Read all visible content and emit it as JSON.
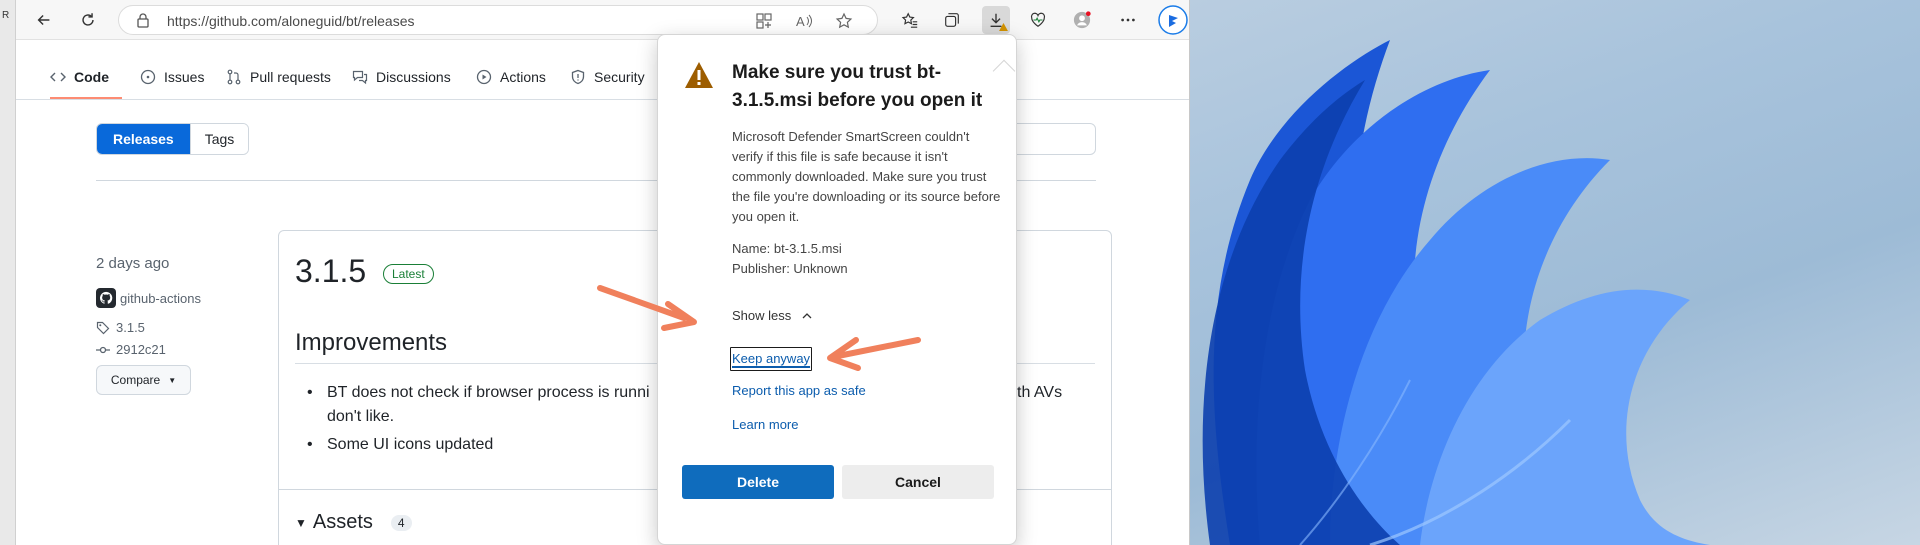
{
  "window": {
    "left_edge_label": "R"
  },
  "browser": {
    "url": "https://github.com/aloneguid/bt/releases"
  },
  "repo_nav": {
    "tabs": [
      "Code",
      "Issues",
      "Pull requests",
      "Discussions",
      "Actions",
      "Security"
    ]
  },
  "releases_page": {
    "segment_releases": "Releases",
    "segment_tags": "Tags",
    "search_placeholder_fragment": "e",
    "release": {
      "date": "2 days ago",
      "author": "github-actions",
      "tag": "3.1.5",
      "commit": "2912c21",
      "compare_label": "Compare",
      "version": "3.1.5",
      "latest_label": "Latest",
      "section_title": "Improvements",
      "note1_visible_left": "BT does not check if browser process is runni",
      "note1_visible_right": "th AVs",
      "note1_line2": "don't like.",
      "note2": "Some UI icons updated",
      "assets_label": "Assets",
      "assets_count": "4"
    }
  },
  "smartscreen_popup": {
    "title": "Make sure you trust bt-3.1.5.msi before you open it",
    "body": "Microsoft Defender SmartScreen couldn't verify if this file is safe because it isn't commonly downloaded. Make sure you trust the file you're downloading or its source before you open it.",
    "file_name": "Name: bt-3.1.5.msi",
    "publisher": "Publisher: Unknown",
    "show_less": "Show less",
    "keep_anyway": "Keep anyway",
    "report_safe": "Report this app as safe",
    "learn_more": "Learn more",
    "delete_label": "Delete",
    "cancel_label": "Cancel"
  },
  "colors": {
    "accent_blue": "#0f6cbd",
    "warning_amber": "#9d5d00",
    "annotation_arrow": "#f0805c",
    "github_primary": "#0969da",
    "latest_green": "#1a7f37"
  }
}
